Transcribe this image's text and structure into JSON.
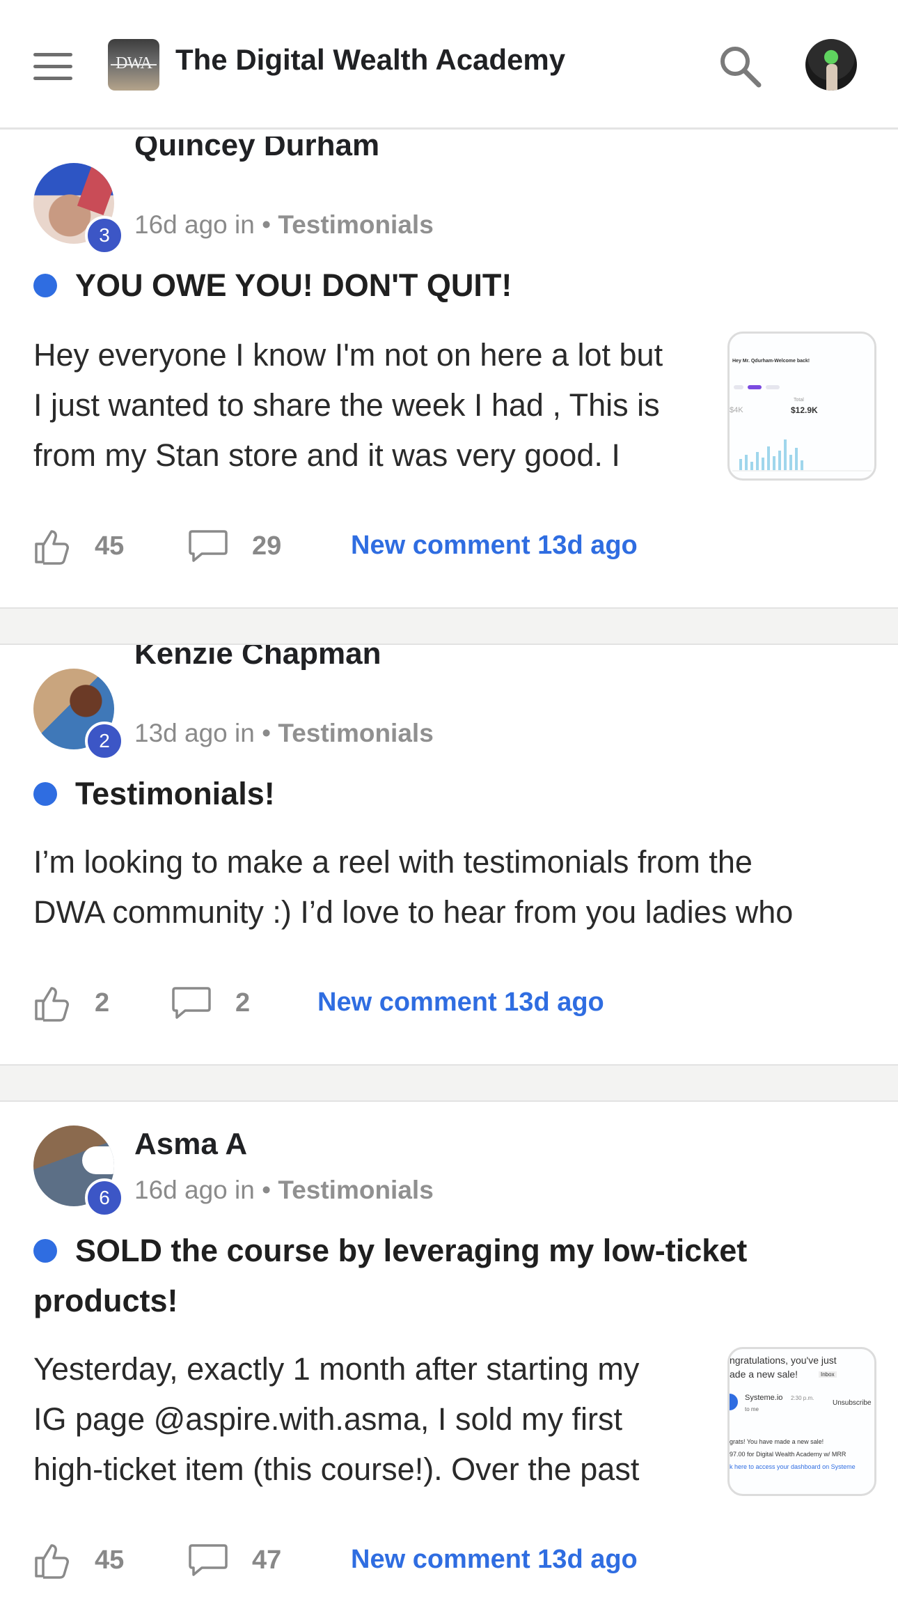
{
  "header": {
    "logo_text": "DWA",
    "title": "The Digital Wealth Academy",
    "menu_icon": "hamburger-menu-icon",
    "search_icon": "search-icon"
  },
  "posts": [
    {
      "author": "Quincey Durham",
      "level": "3",
      "meta_time": "16d ago in",
      "category": "Testimonials",
      "title": "YOU OWE YOU! DON'T QUIT!",
      "body": [
        "Hey everyone I know I'm not on here a lot but",
        "I just wanted to share the week I had , This is",
        "from my Stan store and it was very good. I"
      ],
      "likes": "45",
      "comments": "29",
      "new_comment": "New comment 13d ago",
      "thumb": {
        "greeting": "Hey Mr. Qdurham-Welcome back!",
        "total_label": "Total",
        "total": "$12.9K",
        "left_value": "$4K"
      }
    },
    {
      "author": "Kenzie Chapman",
      "level": "2",
      "meta_time": "13d ago in",
      "category": "Testimonials",
      "title": "Testimonials!",
      "body": [
        "I’m looking to make a reel with testimonials from the",
        "DWA community :) I’d love to hear from you ladies who"
      ],
      "likes": "2",
      "comments": "2",
      "new_comment": "New comment 13d ago"
    },
    {
      "author": "Asma A",
      "level": "6",
      "meta_time": "16d ago in",
      "category": "Testimonials",
      "title_line1": "SOLD the course by leveraging my low-ticket",
      "title_line2": "products!",
      "body": [
        "Yesterday, exactly 1 month after starting my",
        "IG page @aspire.with.asma, I sold my first",
        "high-ticket item (this course!). Over the past"
      ],
      "likes": "45",
      "comments": "47",
      "new_comment": "New comment 13d ago",
      "thumb": {
        "line1": "ngratulations, you've just",
        "line2": "ade a new sale!",
        "inbox": "Inbox",
        "sender": "Systeme.io",
        "time": "2:30 p.m.",
        "to": "to me",
        "unsubscribe": "Unsubscribe",
        "msg1": "grats! You have made a new sale!",
        "msg2": "97.00 for Digital Wealth Academy w/ MRR",
        "link": "k here to access your dashboard on Systeme"
      }
    }
  ],
  "colors": {
    "accent": "#2f6de1",
    "badge": "#3c56c6",
    "muted": "#8a8a8a"
  }
}
